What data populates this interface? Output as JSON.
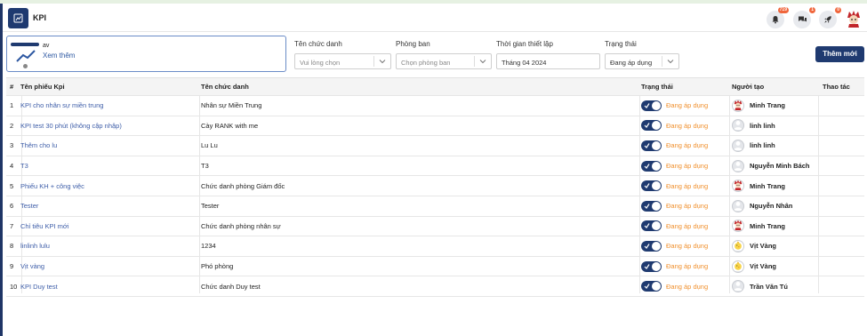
{
  "app": {
    "title": "KPI"
  },
  "header": {
    "notifications_count": "719",
    "messages_count": "1",
    "updates_count": "0"
  },
  "card": {
    "name": "av",
    "more": "Xem thêm"
  },
  "filters": {
    "title_label": "Tên chức danh",
    "title_placeholder": "Vui lòng chọn",
    "dept_label": "Phòng ban",
    "dept_placeholder": "Chọn phòng ban",
    "time_label": "Thời gian thiết lập",
    "time_value": "Tháng 04 2024",
    "status_label": "Trạng thái",
    "status_value": "Đang áp dụng",
    "add_button": "Thêm mới"
  },
  "table": {
    "headers": {
      "no": "#",
      "name": "Tên phiếu Kpi",
      "title": "Tên chức danh",
      "status": "Trạng thái",
      "creator": "Người tạo",
      "action": "Thao tác"
    },
    "rows": [
      {
        "no": "1",
        "name": "KPI cho nhân sự miền trung",
        "title": "Nhân sự Miền Trung",
        "status": "Đang áp dụng",
        "creator": "Minh Trang",
        "avatar": "char-red"
      },
      {
        "no": "2",
        "name": "KPI test 30 phút (không cập nhập)",
        "title": "Cày RANK with me",
        "status": "Đang áp dụng",
        "creator": "linh linh",
        "avatar": "default"
      },
      {
        "no": "3",
        "name": "Thêm cho lu",
        "title": "Lu Lu",
        "status": "Đang áp dụng",
        "creator": "linh linh",
        "avatar": "default"
      },
      {
        "no": "4",
        "name": "T3",
        "title": "T3",
        "status": "Đang áp dụng",
        "creator": "Nguyễn Minh Bách",
        "avatar": "default"
      },
      {
        "no": "5",
        "name": "Phiếu KH + công việc",
        "title": "Chức danh phòng Giám đốc",
        "status": "Đang áp dụng",
        "creator": "Minh Trang",
        "avatar": "char-red"
      },
      {
        "no": "6",
        "name": "Tester",
        "title": "Tester",
        "status": "Đang áp dụng",
        "creator": "Nguyễn Nhân",
        "avatar": "default"
      },
      {
        "no": "7",
        "name": "Chỉ tiêu KPI mới",
        "title": "Chức danh phòng nhân sự",
        "status": "Đang áp dụng",
        "creator": "Minh Trang",
        "avatar": "char-red"
      },
      {
        "no": "8",
        "name": "linlinh lulu",
        "title": "1234",
        "status": "Đang áp dụng",
        "creator": "Vịt Vàng",
        "avatar": "duck"
      },
      {
        "no": "9",
        "name": "Vịt vàng",
        "title": "Phó phòng",
        "status": "Đang áp dụng",
        "creator": "Vịt Vàng",
        "avatar": "duck"
      },
      {
        "no": "10",
        "name": "KPI Duy test",
        "title": "Chức danh Duy test",
        "status": "Đang áp dụng",
        "creator": "Trần Văn Tú",
        "avatar": "default"
      }
    ]
  },
  "colors": {
    "brand": "#1f3a70",
    "link": "#3d5da8",
    "status": "#f0902e",
    "badge": "#f0663c"
  }
}
